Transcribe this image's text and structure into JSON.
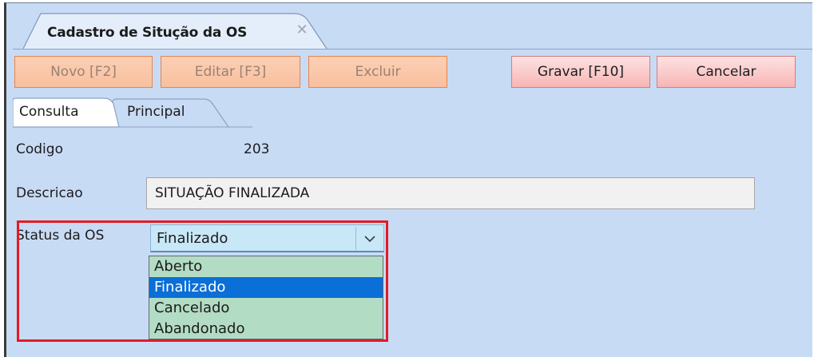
{
  "window": {
    "tab_title": "Cadastro de Situção da OS",
    "close_glyph": "✕"
  },
  "toolbar": {
    "novo_label": "Novo [F2]",
    "editar_label": "Editar [F3]",
    "excluir_label": "Excluir",
    "gravar_label": "Gravar [F10]",
    "cancelar_label": "Cancelar"
  },
  "tabs": {
    "consulta": "Consulta",
    "principal": "Principal"
  },
  "form": {
    "codigo_label": "Codigo",
    "codigo_value": "203",
    "descricao_label": "Descricao",
    "descricao_value": "SITUAÇÃO FINALIZADA",
    "status_label": "Status da OS",
    "status_value": "Finalizado",
    "status_options": [
      "Aberto",
      "Finalizado",
      "Cancelado",
      "Abandonado"
    ],
    "selected_index": 1
  },
  "colors": {
    "window_bg": "#c8dbf5",
    "highlight": "#e31b23",
    "dropdown_bg": "#b2dcc3",
    "selection": "#0a6fd6"
  },
  "icons": {
    "close": "close-icon",
    "dropdown": "chevron-down-icon"
  }
}
